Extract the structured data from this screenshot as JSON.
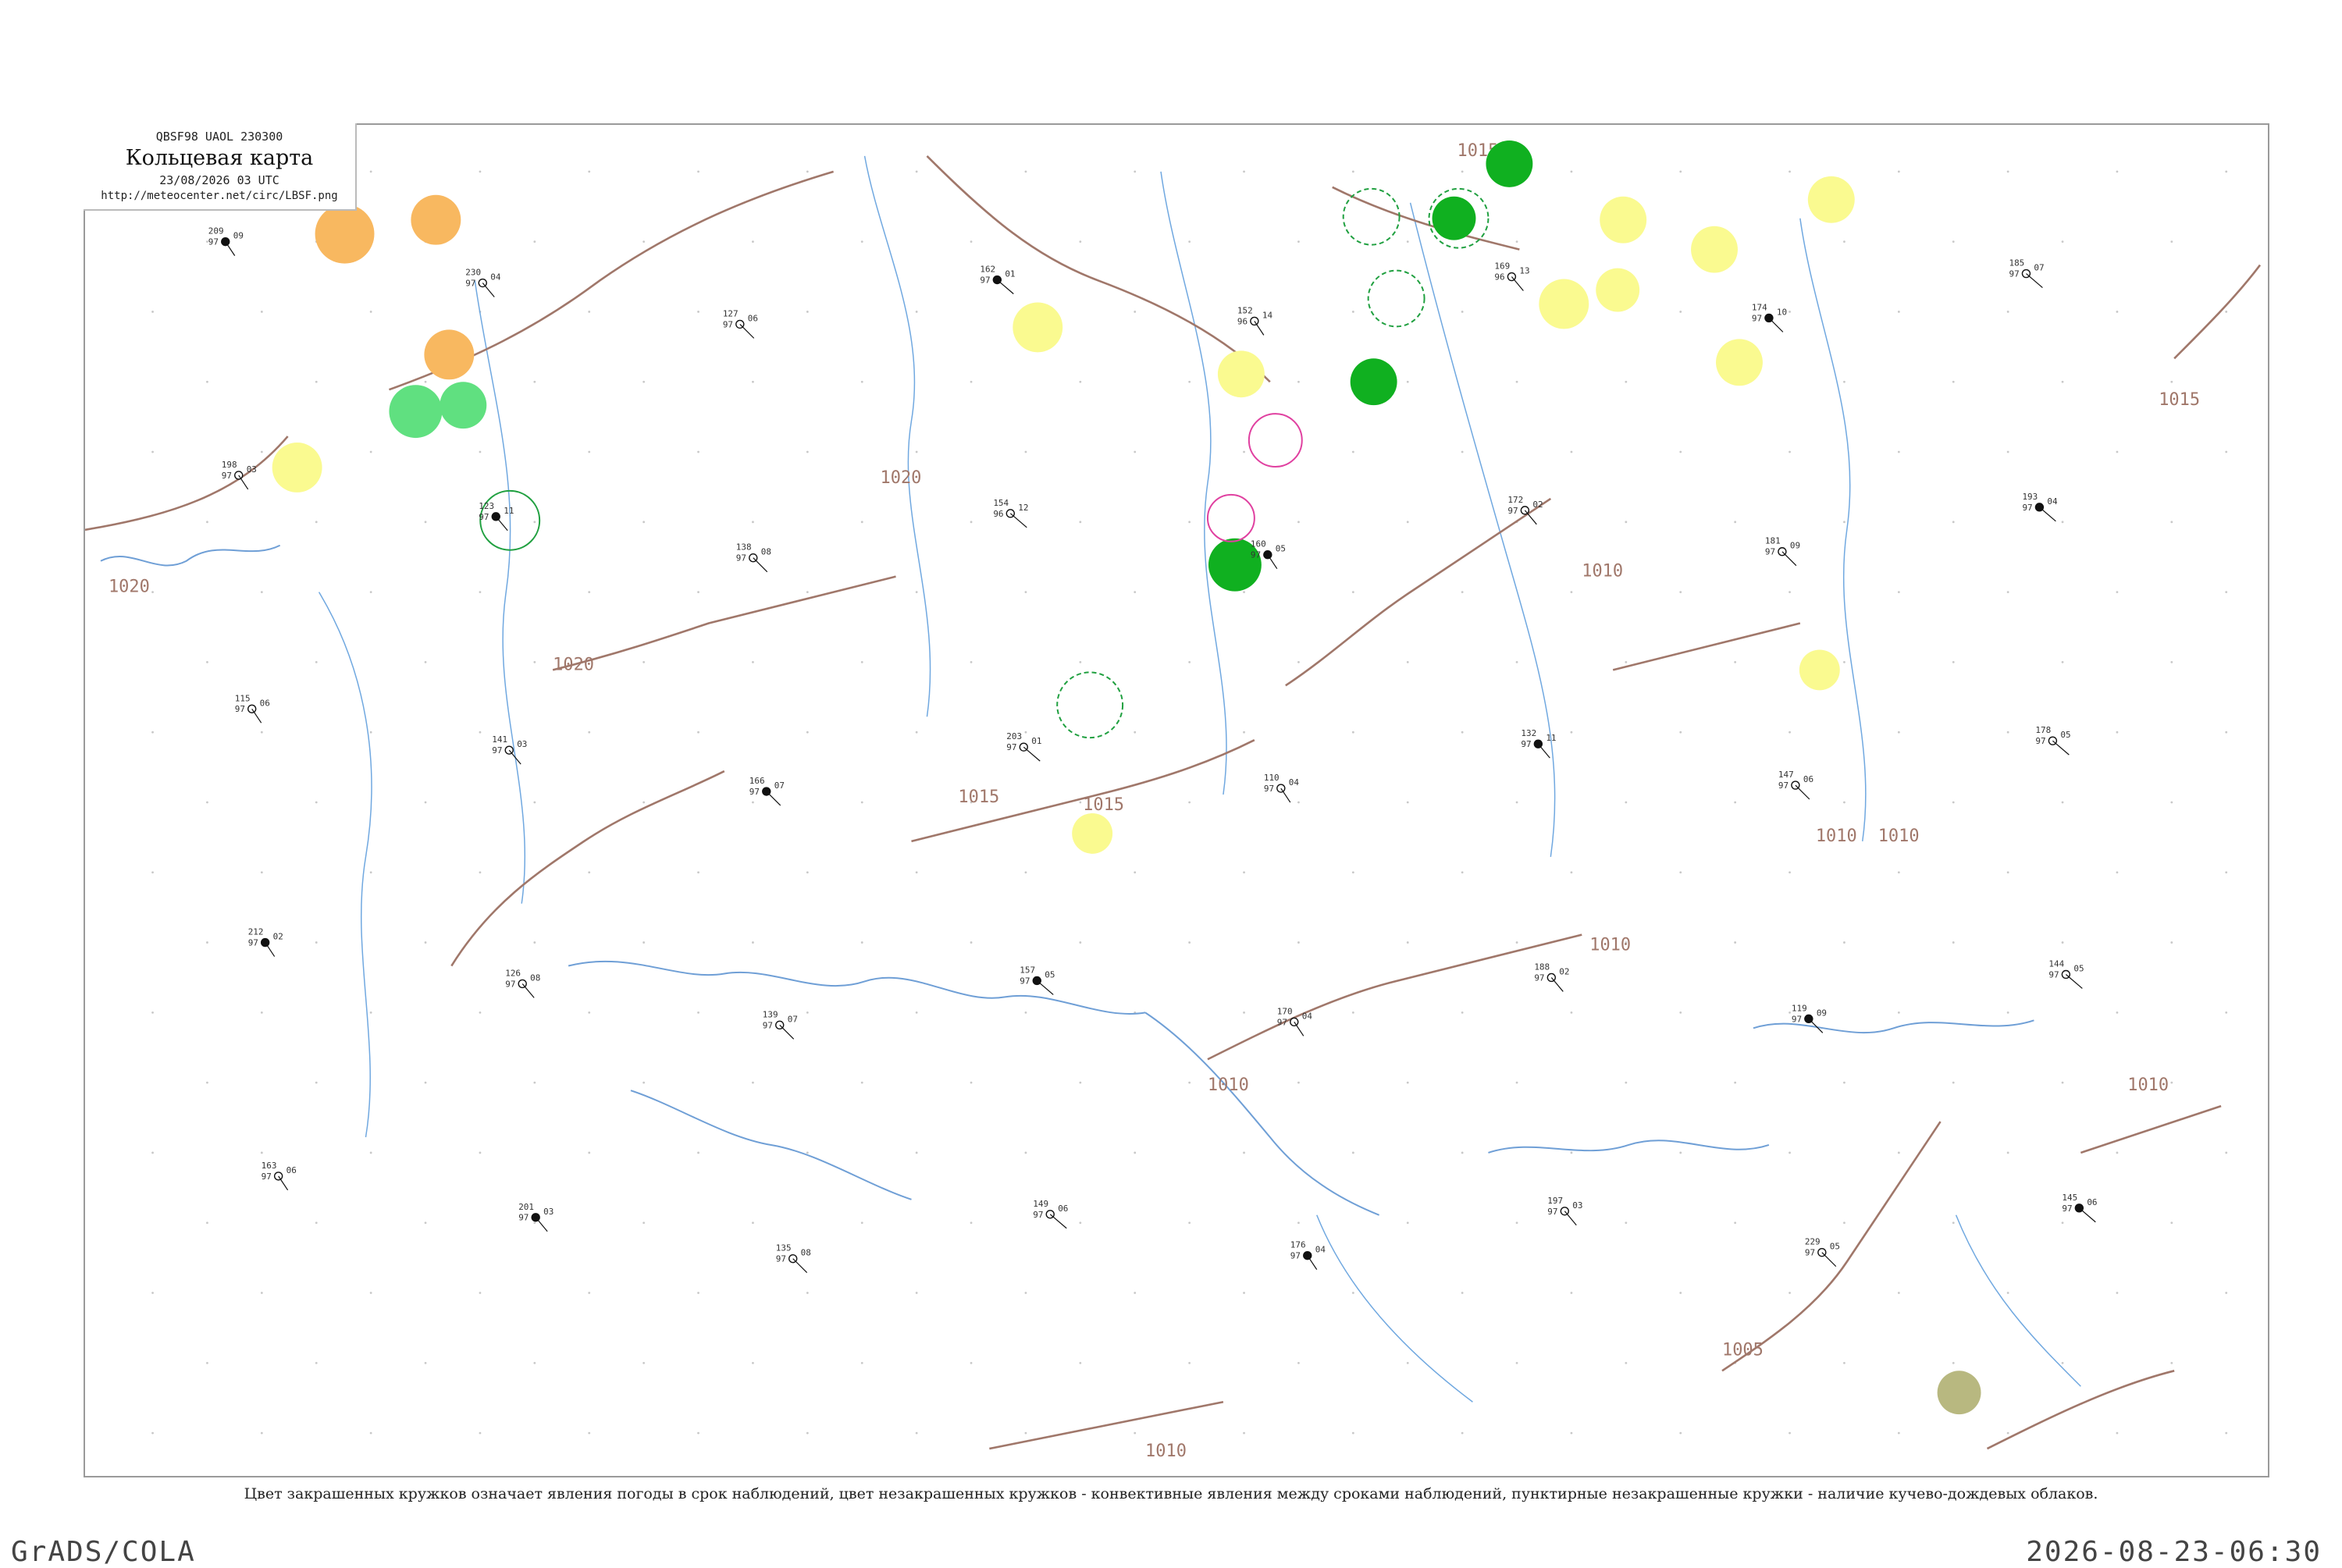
{
  "header": {
    "code_line": "QBSF98  UAOL  230300",
    "title": "Кольцевая карта",
    "datetime": "23/08/2026 03 UTC",
    "url": "http://meteocenter.net/circ/LBSF.png"
  },
  "caption": "Цвет закрашенных кружков означает явления погоды в срок наблюдений, цвет незакрашенных кружков - конвективные явления между сроками наблюдений, пунктирные незакрашенные кружки - наличие кучево-дождевых облаков.",
  "footer": {
    "left": "GrADS/COLA",
    "right": "2026-08-23-06:30"
  },
  "colors": {
    "isobar": "#a0776a",
    "water": "#70a8e0",
    "yellow_marker": "#fafa90",
    "orange_marker": "#f8b860",
    "light_green_marker": "#60e080",
    "green_marker": "#10b020",
    "olive_marker": "#b8b880",
    "pink_ring": "#e040a0",
    "green_ring": "#20a040"
  },
  "isobar_labels": [
    "1020",
    "1020",
    "1020",
    "1015",
    "1015",
    "1015",
    "1015",
    "1010",
    "1010",
    "1010",
    "1010",
    "1010",
    "1010",
    "1005",
    "1010"
  ],
  "stations": [
    {
      "t": "209",
      "p": "97",
      "d": "09"
    },
    {
      "t": "230",
      "p": "97",
      "d": "04"
    },
    {
      "t": "127",
      "p": "97",
      "d": "06"
    },
    {
      "t": "162",
      "p": "97",
      "d": "01"
    },
    {
      "t": "152",
      "p": "96",
      "d": "14"
    },
    {
      "t": "169",
      "p": "96",
      "d": "13"
    },
    {
      "t": "174",
      "p": "97",
      "d": "10"
    },
    {
      "t": "185",
      "p": "97",
      "d": "07"
    },
    {
      "t": "198",
      "p": "97",
      "d": "03"
    },
    {
      "t": "123",
      "p": "97",
      "d": "11"
    },
    {
      "t": "138",
      "p": "97",
      "d": "08"
    },
    {
      "t": "154",
      "p": "96",
      "d": "12"
    },
    {
      "t": "160",
      "p": "97",
      "d": "05"
    },
    {
      "t": "172",
      "p": "97",
      "d": "02"
    },
    {
      "t": "181",
      "p": "97",
      "d": "09"
    },
    {
      "t": "193",
      "p": "97",
      "d": "04"
    },
    {
      "t": "115",
      "p": "97",
      "d": "06"
    },
    {
      "t": "141",
      "p": "97",
      "d": "03"
    },
    {
      "t": "166",
      "p": "97",
      "d": "07"
    },
    {
      "t": "203",
      "p": "97",
      "d": "01"
    },
    {
      "t": "110",
      "p": "97",
      "d": "04"
    },
    {
      "t": "132",
      "p": "97",
      "d": "11"
    },
    {
      "t": "147",
      "p": "97",
      "d": "06"
    },
    {
      "t": "178",
      "p": "97",
      "d": "05"
    },
    {
      "t": "212",
      "p": "97",
      "d": "02"
    },
    {
      "t": "126",
      "p": "97",
      "d": "08"
    },
    {
      "t": "139",
      "p": "97",
      "d": "07"
    },
    {
      "t": "157",
      "p": "97",
      "d": "05"
    },
    {
      "t": "170",
      "p": "97",
      "d": "04"
    },
    {
      "t": "188",
      "p": "97",
      "d": "02"
    },
    {
      "t": "119",
      "p": "97",
      "d": "09"
    },
    {
      "t": "144",
      "p": "97",
      "d": "05"
    },
    {
      "t": "163",
      "p": "97",
      "d": "06"
    },
    {
      "t": "201",
      "p": "97",
      "d": "03"
    },
    {
      "t": "135",
      "p": "97",
      "d": "08"
    },
    {
      "t": "149",
      "p": "97",
      "d": "06"
    },
    {
      "t": "176",
      "p": "97",
      "d": "04"
    },
    {
      "t": "197",
      "p": "97",
      "d": "03"
    },
    {
      "t": "229",
      "p": "97",
      "d": "05"
    },
    {
      "t": "145",
      "p": "97",
      "d": "06"
    }
  ]
}
